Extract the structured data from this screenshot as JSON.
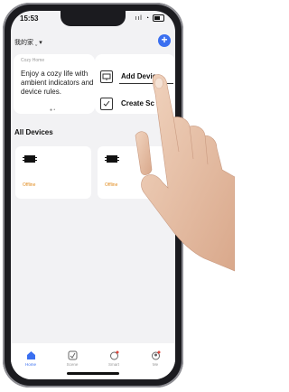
{
  "status_bar": {
    "time": "15:53",
    "signal": "ııl",
    "wifi": "◔"
  },
  "header": {
    "home_name": "我的家 ˬ ▾",
    "add_symbol": "+"
  },
  "scene_card": {
    "title": "Cozy Home",
    "description": "Enjoy a cozy life with ambient indicators and device rules.",
    "dots": "● •"
  },
  "menu": {
    "items": [
      {
        "label": "Add Device",
        "icon": "add-device-icon"
      },
      {
        "label": "Create Sc",
        "icon": "create-scene-icon"
      }
    ]
  },
  "section": {
    "title": "All Devices"
  },
  "devices": [
    {
      "status": "Offline"
    },
    {
      "status": "Offline"
    }
  ],
  "tabs": [
    {
      "label": "Home",
      "icon": "home-icon",
      "active": true
    },
    {
      "label": "Scene",
      "icon": "scene-icon"
    },
    {
      "label": "Smart",
      "icon": "smart-icon"
    },
    {
      "label": "Me",
      "icon": "me-icon"
    }
  ],
  "colors": {
    "accent": "#3a6ff0",
    "offline": "#e08a1c",
    "background": "#f2f2f4"
  }
}
